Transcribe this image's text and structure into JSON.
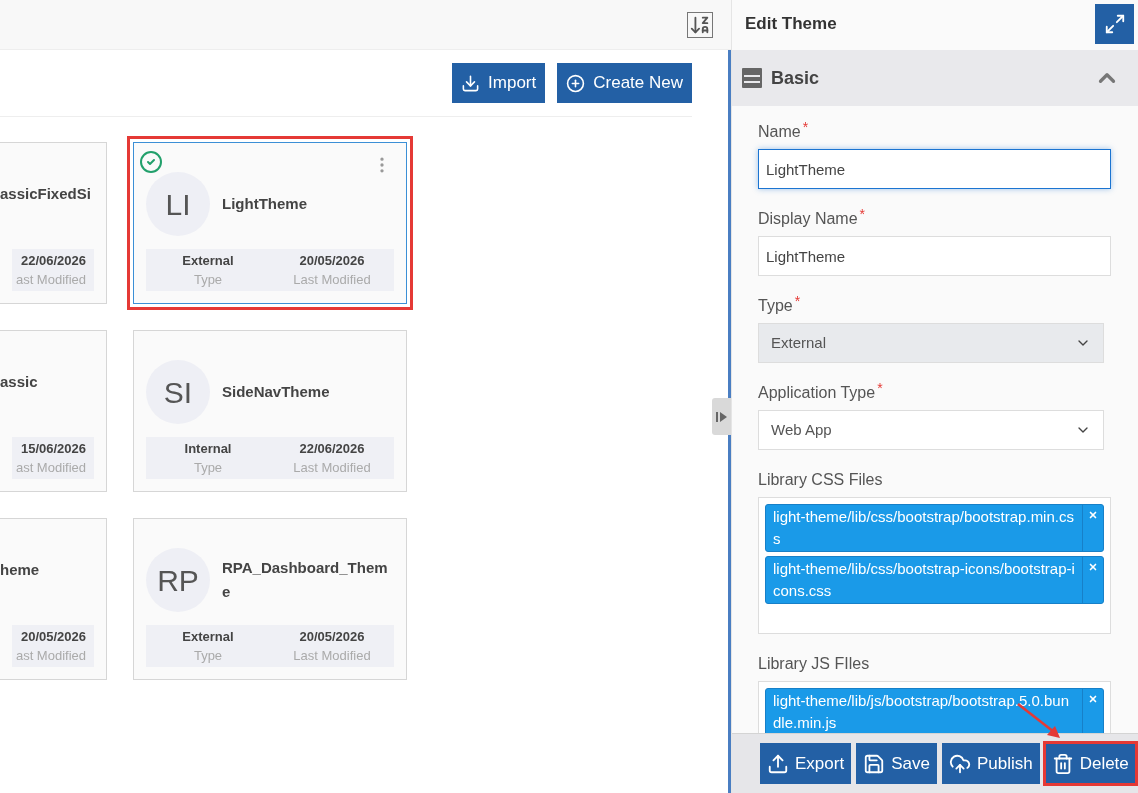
{
  "toolbar": {
    "buttons": [
      {
        "label": "Import",
        "kind": "import"
      },
      {
        "label": "Create New",
        "kind": "create"
      }
    ]
  },
  "cards": [
    {
      "kind": "clipped",
      "name": "assicFixedSi",
      "date": "22/06/2026",
      "date_label": "ast Modified"
    },
    {
      "kind": "full",
      "initials": "LI",
      "name": "LightTheme",
      "type": "External",
      "type_label": "Type",
      "date": "20/05/2026",
      "date_label": "Last Modified",
      "selected": true,
      "active": true,
      "highlighted": true
    },
    {
      "kind": "clipped",
      "name": "assic",
      "date": "15/06/2026",
      "date_label": "ast Modified"
    },
    {
      "kind": "full",
      "initials": "SI",
      "name": "SideNavTheme",
      "type": "Internal",
      "type_label": "Type",
      "date": "22/06/2026",
      "date_label": "Last Modified",
      "selected": false,
      "active": false,
      "highlighted": false
    },
    {
      "kind": "clipped",
      "name": "heme",
      "date": "20/05/2026",
      "date_label": "ast Modified"
    },
    {
      "kind": "full",
      "initials": "RP",
      "name": "RPA_Dashboard_Theme",
      "type": "External",
      "type_label": "Type",
      "date": "20/05/2026",
      "date_label": "Last Modified",
      "selected": false,
      "active": false,
      "highlighted": false
    }
  ],
  "panel": {
    "title": "Edit Theme",
    "section": {
      "title": "Basic",
      "expanded": true
    },
    "fields": [
      {
        "kind": "text",
        "label": "Name",
        "required_mark": "*",
        "value": "LightTheme",
        "focused": true
      },
      {
        "kind": "text",
        "label": "Display Name",
        "required_mark": "*",
        "value": "LightTheme",
        "focused": false
      },
      {
        "kind": "select",
        "label": "Type",
        "required_mark": "*",
        "value": "External",
        "disabled": true
      },
      {
        "kind": "select",
        "label": "Application Type",
        "required_mark": "*",
        "value": "Web App",
        "disabled": false
      },
      {
        "kind": "tags",
        "label": "Library CSS Files",
        "tags": [
          "light-theme/lib/css/bootstrap/bootstrap.min.css",
          "light-theme/lib/css/bootstrap-icons/bootstrap-icons.css"
        ]
      },
      {
        "kind": "tags",
        "label": "Library JS FIles",
        "tags": [
          "light-theme/lib/js/bootstrap/bootstrap.5.0.bundle.min.js"
        ]
      }
    ],
    "footer_buttons": [
      {
        "label": "Export",
        "kind": "export",
        "highlighted": false
      },
      {
        "label": "Save",
        "kind": "save",
        "highlighted": false
      },
      {
        "label": "Publish",
        "kind": "publish",
        "highlighted": false
      },
      {
        "label": "Delete",
        "kind": "delete",
        "highlighted": true
      }
    ]
  }
}
